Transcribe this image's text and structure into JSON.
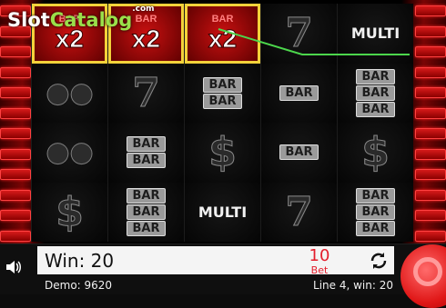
{
  "logo": {
    "slot": "Slot",
    "catalog": "Catalog",
    "domain": ".com"
  },
  "reels": [
    [
      {
        "type": "x2",
        "top": "BAR",
        "label": "x2"
      },
      {
        "type": "cherry",
        "label": ""
      },
      {
        "type": "cherry",
        "label": ""
      },
      {
        "type": "dollar",
        "label": "$"
      }
    ],
    [
      {
        "type": "x2",
        "top": "BAR",
        "label": "x2"
      },
      {
        "type": "seven",
        "label": "7"
      },
      {
        "type": "bar",
        "label": "BAR BAR"
      },
      {
        "type": "bar3",
        "label": "BAR BAR BAR"
      }
    ],
    [
      {
        "type": "x2",
        "top": "BAR",
        "label": "x2"
      },
      {
        "type": "bar",
        "label": "BAR BAR"
      },
      {
        "type": "dollar",
        "label": "$"
      },
      {
        "type": "multi",
        "label": "MULTI"
      }
    ],
    [
      {
        "type": "seven",
        "label": "7"
      },
      {
        "type": "bar1",
        "label": "BAR"
      },
      {
        "type": "bar1",
        "label": "BAR"
      },
      {
        "type": "seven",
        "label": "7"
      }
    ],
    [
      {
        "type": "multi",
        "label": "MULTI"
      },
      {
        "type": "bar3",
        "label": "BAR BAR BAR"
      },
      {
        "type": "dollar",
        "label": "$"
      },
      {
        "type": "bar3",
        "label": "BAR BAR BAR"
      }
    ]
  ],
  "status": {
    "win_label": "Win:",
    "win_value": "20",
    "bet_value": "10",
    "bet_label": "Bet",
    "demo_label": "Demo:",
    "demo_value": "9620",
    "line_win_text": "Line 4, win: 20"
  },
  "icons": {
    "sound": "speaker-icon",
    "autoplay": "refresh-icon"
  },
  "colors": {
    "accent_red": "#e31e2c",
    "win_frame": "#f3d23a",
    "payline": "#4cd64c"
  }
}
